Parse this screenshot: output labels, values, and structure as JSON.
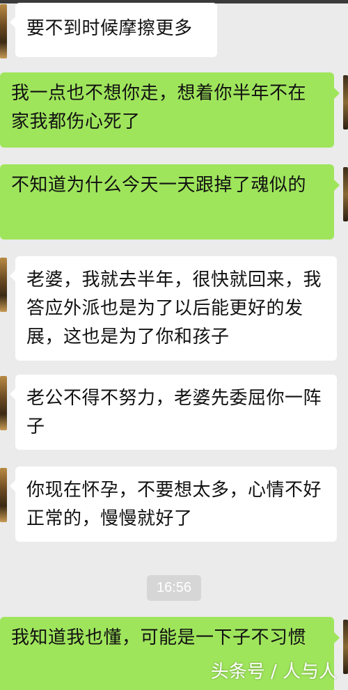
{
  "messages": [
    {
      "side": "in",
      "text": "要不到时候摩擦更多"
    },
    {
      "side": "out",
      "text": "我一点也不想你走，想着你半年不在家我都伤心死了"
    },
    {
      "side": "out",
      "text": "不知道为什么今天一天跟掉了魂似的"
    },
    {
      "side": "in",
      "text": "老婆，我就去半年，很快就回来，我答应外派也是为了以后能更好的发展，这也是为了你和孩子"
    },
    {
      "side": "in",
      "text": "老公不得不努力，老婆先委屈你一阵子"
    },
    {
      "side": "in",
      "text": "你现在怀孕，不要想太多，心情不好正常的，慢慢就好了"
    },
    {
      "side": "out",
      "text": "我知道我也懂，可能是一下子不习惯"
    }
  ],
  "timestamp": "16:56",
  "watermark": "头条号 / 人与人",
  "colors": {
    "background": "#ebebeb",
    "incoming_bubble": "#ffffff",
    "outgoing_bubble": "#9fe55c",
    "timestamp_pill": "#d6d6d6"
  }
}
